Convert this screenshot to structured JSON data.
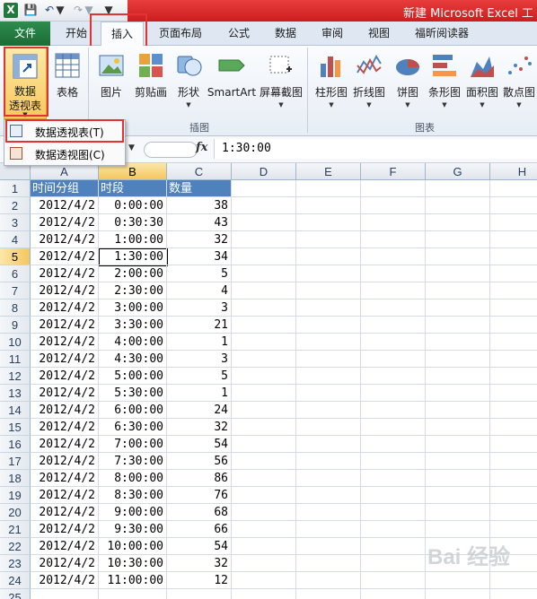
{
  "window": {
    "title": "新建 Microsoft Excel 工",
    "app_icon": "X",
    "colors": {
      "title_accent": "#d42a2a",
      "file_tab": "#217a3f",
      "header_fill": "#4f81bd",
      "highlight_box": "#e23232"
    }
  },
  "ribbon": {
    "tabs": [
      {
        "label": "文件"
      },
      {
        "label": "开始"
      },
      {
        "label": "插入",
        "active": true
      },
      {
        "label": "页面布局"
      },
      {
        "label": "公式"
      },
      {
        "label": "数据"
      },
      {
        "label": "审阅"
      },
      {
        "label": "视图"
      },
      {
        "label": "福昕阅读器"
      }
    ],
    "groups": {
      "illustrations": "插图",
      "charts": "图表"
    },
    "buttons": {
      "pivot_line1": "数据",
      "pivot_line2": "透视表",
      "table": "表格",
      "picture": "图片",
      "clipart": "剪贴画",
      "shapes": "形状",
      "smartart": "SmartArt",
      "screenshot": "屏幕截图",
      "column": "柱形图",
      "line": "折线图",
      "pie": "饼图",
      "bar": "条形图",
      "area": "面积图",
      "scatter": "散点图"
    },
    "pivot_menu": {
      "item1": "数据透视表(T)",
      "item2": "数据透视图(C)"
    }
  },
  "formula_bar": {
    "fx": "fx",
    "value": "1:30:00"
  },
  "sheet": {
    "columns": [
      "A",
      "B",
      "C",
      "D",
      "E",
      "F",
      "G",
      "H"
    ],
    "header_row": {
      "a": "时间分组",
      "b": "时段",
      "c": "数量"
    },
    "rows": [
      {
        "a": "2012/4/2",
        "b": "0:00:00",
        "c": "38"
      },
      {
        "a": "2012/4/2",
        "b": "0:30:30",
        "c": "43"
      },
      {
        "a": "2012/4/2",
        "b": "1:00:00",
        "c": "32"
      },
      {
        "a": "2012/4/2",
        "b": "1:30:00",
        "c": "34"
      },
      {
        "a": "2012/4/2",
        "b": "2:00:00",
        "c": "5"
      },
      {
        "a": "2012/4/2",
        "b": "2:30:00",
        "c": "4"
      },
      {
        "a": "2012/4/2",
        "b": "3:00:00",
        "c": "3"
      },
      {
        "a": "2012/4/2",
        "b": "3:30:00",
        "c": "21"
      },
      {
        "a": "2012/4/2",
        "b": "4:00:00",
        "c": "1"
      },
      {
        "a": "2012/4/2",
        "b": "4:30:00",
        "c": "3"
      },
      {
        "a": "2012/4/2",
        "b": "5:00:00",
        "c": "5"
      },
      {
        "a": "2012/4/2",
        "b": "5:30:00",
        "c": "1"
      },
      {
        "a": "2012/4/2",
        "b": "6:00:00",
        "c": "24"
      },
      {
        "a": "2012/4/2",
        "b": "6:30:00",
        "c": "32"
      },
      {
        "a": "2012/4/2",
        "b": "7:00:00",
        "c": "54"
      },
      {
        "a": "2012/4/2",
        "b": "7:30:00",
        "c": "56"
      },
      {
        "a": "2012/4/2",
        "b": "8:00:00",
        "c": "86"
      },
      {
        "a": "2012/4/2",
        "b": "8:30:00",
        "c": "76"
      },
      {
        "a": "2012/4/2",
        "b": "9:00:00",
        "c": "68"
      },
      {
        "a": "2012/4/2",
        "b": "9:30:00",
        "c": "66"
      },
      {
        "a": "2012/4/2",
        "b": "10:00:00",
        "c": "54"
      },
      {
        "a": "2012/4/2",
        "b": "10:30:00",
        "c": "32"
      },
      {
        "a": "2012/4/2",
        "b": "11:00:00",
        "c": "12"
      }
    ],
    "row_numbers": [
      "1",
      "2",
      "3",
      "4",
      "5",
      "6",
      "7",
      "8",
      "9",
      "10",
      "11",
      "12",
      "13",
      "14",
      "15",
      "16",
      "17",
      "18",
      "19",
      "20",
      "21",
      "22",
      "23",
      "24",
      "25"
    ],
    "active_row": "5",
    "active_col": "B"
  },
  "watermark": "Bai 经验"
}
